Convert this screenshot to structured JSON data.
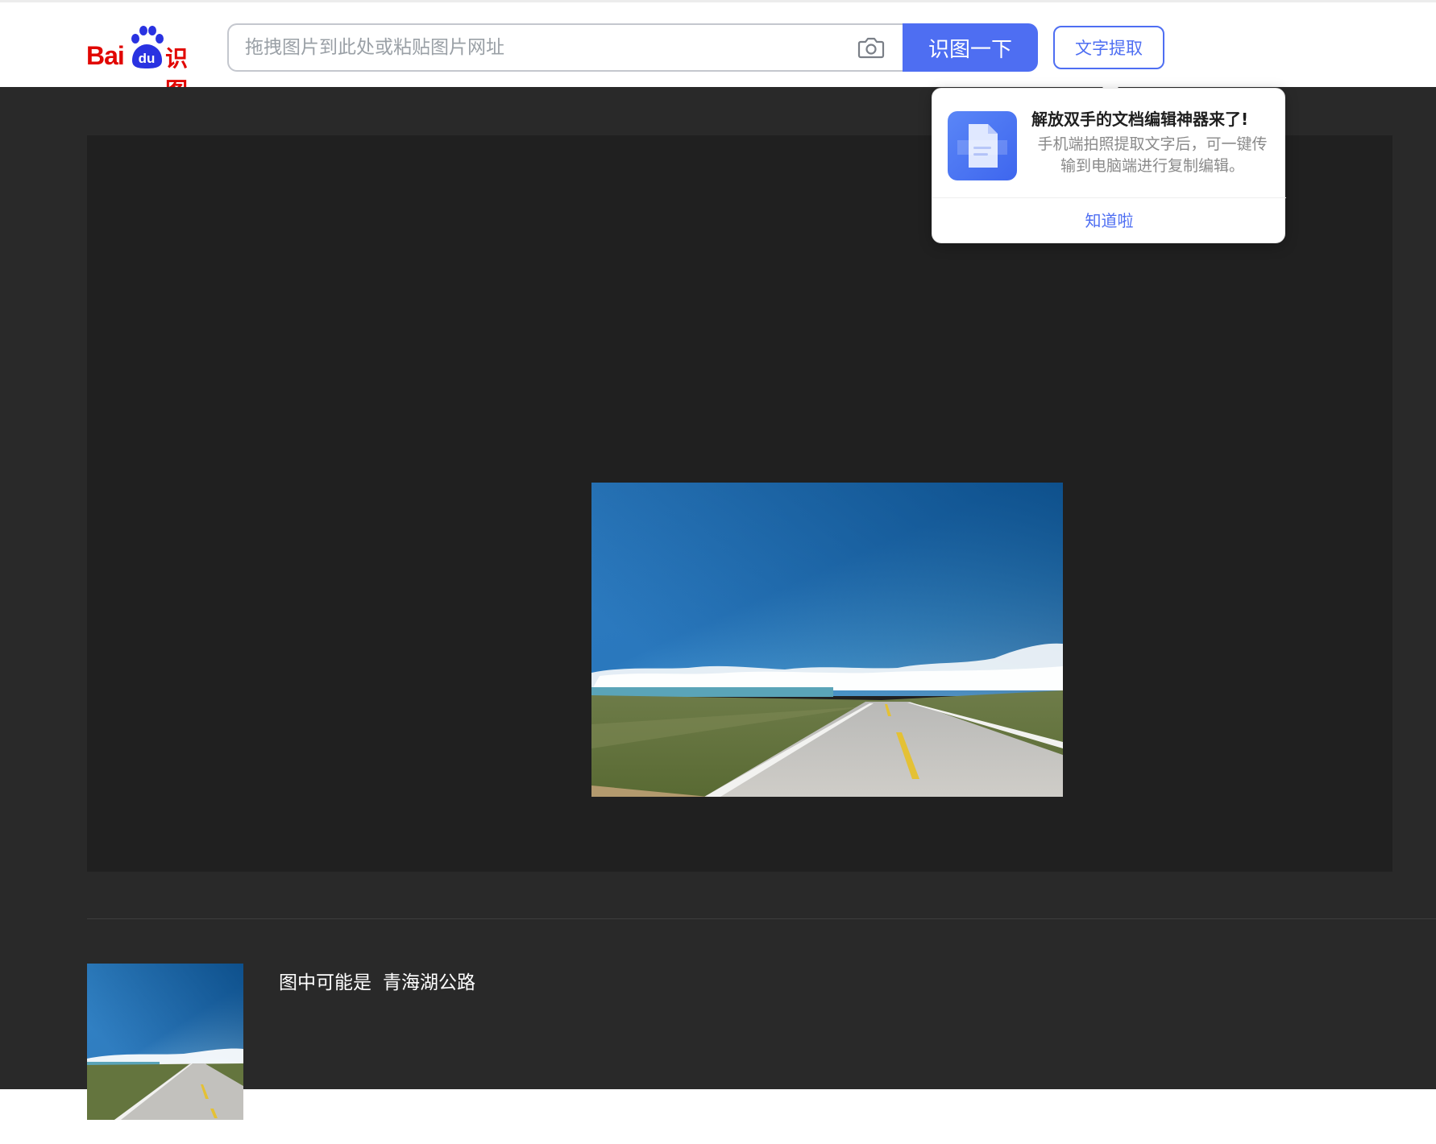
{
  "header": {
    "logo": {
      "bai": "Bai",
      "du": "du",
      "shitu": "识图"
    },
    "search": {
      "placeholder": "拖拽图片到此处或粘贴图片网址",
      "value": ""
    },
    "camera_icon": "camera-icon",
    "search_button": "识图一下",
    "ocr_button": "文字提取"
  },
  "popup": {
    "title": "解放双手的文档编辑神器来了!",
    "desc": "手机端拍照提取文字后，可一键传输到电脑端进行复制编辑。",
    "ok": "知道啦",
    "icon": "document-icon"
  },
  "result": {
    "prefix": "图中可能是",
    "name": "青海湖公路"
  },
  "colors": {
    "accent": "#4e6ef2",
    "brand_red": "#e10601",
    "dark_bg": "#292929",
    "panel_bg": "#202020"
  }
}
